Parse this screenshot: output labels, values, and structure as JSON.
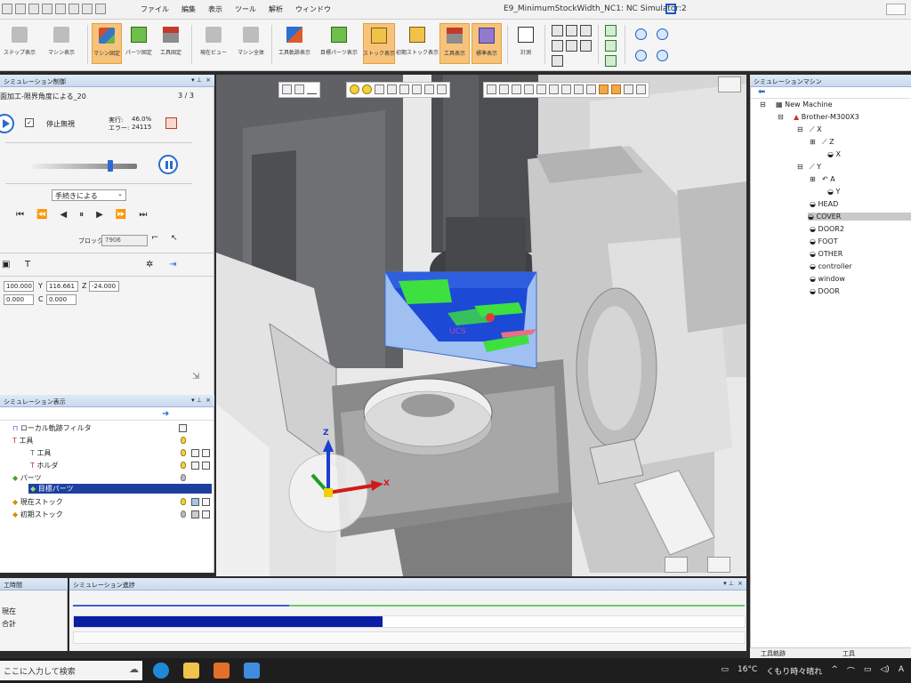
{
  "titlebar": {
    "menu": [
      "ファイル",
      "編集",
      "表示",
      "ツール",
      "解析",
      "ウィンドウ"
    ],
    "window_title": "E9_MinimumStockWidth_NC1: NC Simulator:2"
  },
  "ribbon": {
    "buttons": [
      {
        "label": "ステップ表示"
      },
      {
        "label": "マシン表示"
      },
      {
        "label": "マシン固定"
      },
      {
        "label": "パーツ固定"
      },
      {
        "label": "工具固定"
      },
      {
        "label": "現在ビュー"
      },
      {
        "label": "マシン全体"
      },
      {
        "label": "工具軌跡表示"
      },
      {
        "label": "目標パーツ表示"
      },
      {
        "label": "ストック表示"
      },
      {
        "label": "初期ストック表示"
      },
      {
        "label": "工具表示"
      },
      {
        "label": "標準表示"
      },
      {
        "label": "計測"
      }
    ]
  },
  "sim_control": {
    "header": "シミュレーション制御",
    "operation": "面加工-限界角度による_20",
    "page": "3 / 3",
    "no_stop_label": "停止無視",
    "exec_label": "実行:",
    "exec_value": "46.0%",
    "error_label": "エラー:",
    "error_value": "24115",
    "mode": "手続きによる",
    "block_label": "ブロック",
    "block_value": "7906",
    "coords": {
      "x": "100.000",
      "y_label": "Y",
      "y": "116.661",
      "z_label": "Z",
      "z": "-24.000",
      "b": "0.000",
      "c_label": "C",
      "c": "0.000"
    }
  },
  "sim_display": {
    "header": "シミュレーション表示",
    "items": [
      {
        "label": "ローカル軌跡フィルタ"
      },
      {
        "label": "工具"
      },
      {
        "label": "工具"
      },
      {
        "label": "ホルダ"
      },
      {
        "label": "パーツ"
      },
      {
        "label": "目標パーツ"
      },
      {
        "label": "現在ストック"
      },
      {
        "label": "初期ストック"
      }
    ]
  },
  "machine_tree": {
    "header": "シミュレーションマシン",
    "items": [
      {
        "label": "New Machine"
      },
      {
        "label": "Brother-M300X3"
      },
      {
        "label": "X"
      },
      {
        "label": "Z"
      },
      {
        "label": "X"
      },
      {
        "label": "Y"
      },
      {
        "label": "A"
      },
      {
        "label": "Y"
      },
      {
        "label": "HEAD"
      },
      {
        "label": "COVER"
      },
      {
        "label": "DOOR2"
      },
      {
        "label": "FOOT"
      },
      {
        "label": "OTHER"
      },
      {
        "label": "controller"
      },
      {
        "label": "window"
      },
      {
        "label": "DOOR"
      }
    ],
    "status_left": "工具軌跡",
    "status_right": "工具"
  },
  "bottom": {
    "time_header": "工時間",
    "time_now": "現在",
    "time_total": "合計",
    "progress_header": "シミュレーション進捗",
    "progress_fraction": 0.46
  },
  "viewport": {
    "ucs_label": "UCS",
    "axis_x": "X",
    "axis_z": "Z"
  },
  "taskbar": {
    "search_text": "ここに入力して検索",
    "weather_temp": "16°C",
    "weather_text": "くもり時々晴れ",
    "ime": "A"
  }
}
